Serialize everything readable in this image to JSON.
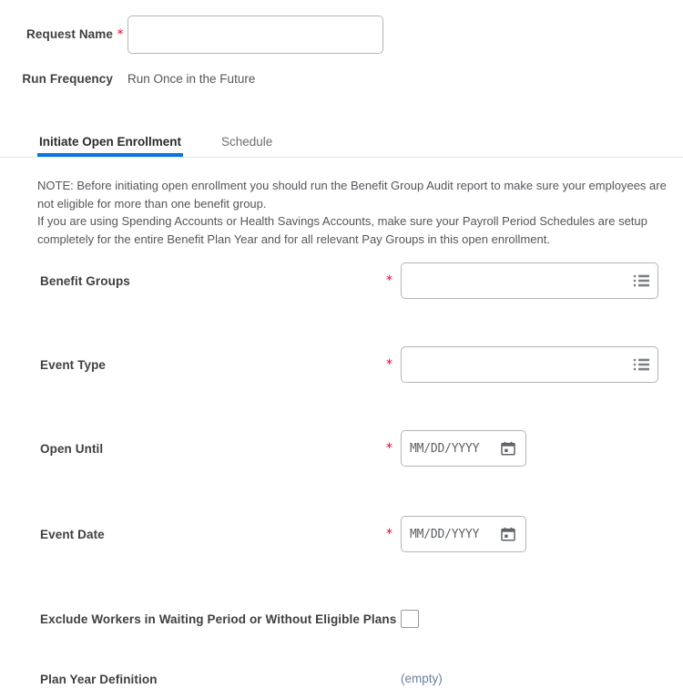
{
  "header": {
    "request_name_label": "Request Name",
    "request_name_value": "",
    "request_name_placeholder": "",
    "required_marker": "*",
    "run_frequency_label": "Run Frequency",
    "run_frequency_value": "Run Once in the Future"
  },
  "tabs": [
    {
      "label": "Initiate Open Enrollment",
      "active": true
    },
    {
      "label": "Schedule",
      "active": false
    }
  ],
  "note": {
    "line1": "NOTE: Before initiating open enrollment you should run the Benefit Group Audit report to make sure your employees are not eligible for more than one benefit group.",
    "line2": "If you are using Spending Accounts or Health Savings Accounts, make sure your Payroll Period Schedules are setup completely for the entire Benefit Plan Year and for all relevant Pay Groups in this open enrollment."
  },
  "form": {
    "benefit_groups": {
      "label": "Benefit Groups",
      "required_marker": "*",
      "value": "",
      "icon": "list-prompt-icon"
    },
    "event_type": {
      "label": "Event Type",
      "required_marker": "*",
      "value": "",
      "icon": "list-prompt-icon"
    },
    "open_until": {
      "label": "Open Until",
      "required_marker": "*",
      "placeholder": "MM/DD/YYYY",
      "value": "",
      "icon": "calendar-icon"
    },
    "event_date": {
      "label": "Event Date",
      "required_marker": "*",
      "placeholder": "MM/DD/YYYY",
      "value": "",
      "icon": "calendar-icon"
    },
    "exclude_workers": {
      "label": "Exclude Workers in Waiting Period or Without Eligible Plans",
      "checked": false
    },
    "plan_year_definition": {
      "label": "Plan Year Definition",
      "value": "(empty)"
    }
  },
  "colors": {
    "accent_blue": "#0875e1",
    "required_red": "#e4002b",
    "label_text": "#3f3f3f",
    "muted_text": "#53565a",
    "link_blue": "#6a7f9b",
    "border_gray": "#b2b5b9"
  }
}
